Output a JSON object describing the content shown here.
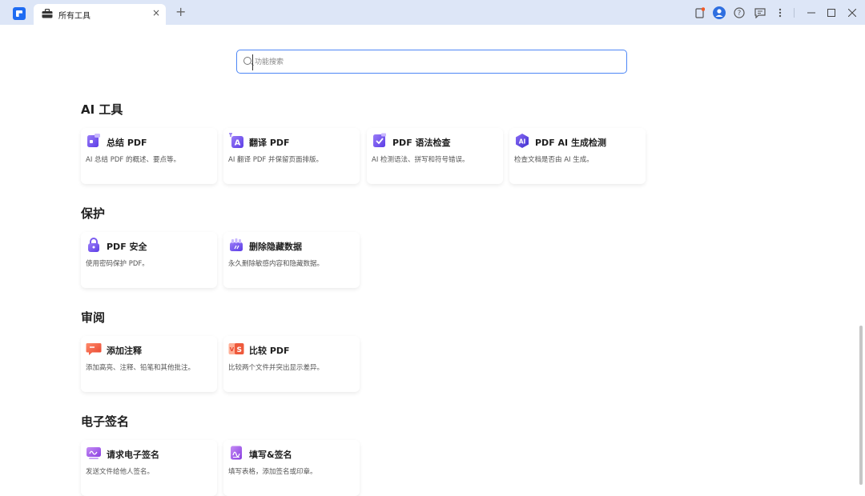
{
  "window": {
    "tab_label": "所有工具",
    "tab_close": "×",
    "new_tab": "+"
  },
  "search": {
    "placeholder": "功能搜索",
    "value": ""
  },
  "sections": [
    {
      "title": "AI 工具",
      "cards": [
        {
          "title": "总结 PDF",
          "desc": "AI 总结 PDF 的概述、要点等。",
          "icon": "summarize-icon"
        },
        {
          "title": "翻译 PDF",
          "desc": "AI 翻译 PDF 并保留页面排版。",
          "icon": "translate-icon"
        },
        {
          "title": "PDF 语法检查",
          "desc": "AI 检测语法、拼写和符号错误。",
          "icon": "grammar-check-icon"
        },
        {
          "title": "PDF AI 生成检测",
          "desc": "检查文档是否由 AI 生成。",
          "icon": "ai-detect-icon"
        }
      ]
    },
    {
      "title": "保护",
      "cards": [
        {
          "title": "PDF 安全",
          "desc": "使用密码保护 PDF。",
          "icon": "lock-icon"
        },
        {
          "title": "删除隐藏数据",
          "desc": "永久删除敏感内容和隐藏数据。",
          "icon": "remove-hidden-data-icon"
        }
      ]
    },
    {
      "title": "审阅",
      "cards": [
        {
          "title": "添加注释",
          "desc": "添加高亮、注释、铅笔和其他批注。",
          "icon": "comment-icon"
        },
        {
          "title": "比较 PDF",
          "desc": "比较两个文件并突出显示差异。",
          "icon": "compare-icon"
        }
      ]
    },
    {
      "title": "电子签名",
      "cards": [
        {
          "title": "请求电子签名",
          "desc": "发送文件给他人签名。",
          "icon": "request-signature-icon"
        },
        {
          "title": "填写&签名",
          "desc": "填写表格，添加签名或印章。",
          "icon": "fill-sign-icon"
        }
      ]
    }
  ],
  "colors": {
    "accent": "#4d87f6",
    "titlebar": "#dde6f7",
    "purple": "#7b5cf0",
    "red": "#f0654e"
  }
}
